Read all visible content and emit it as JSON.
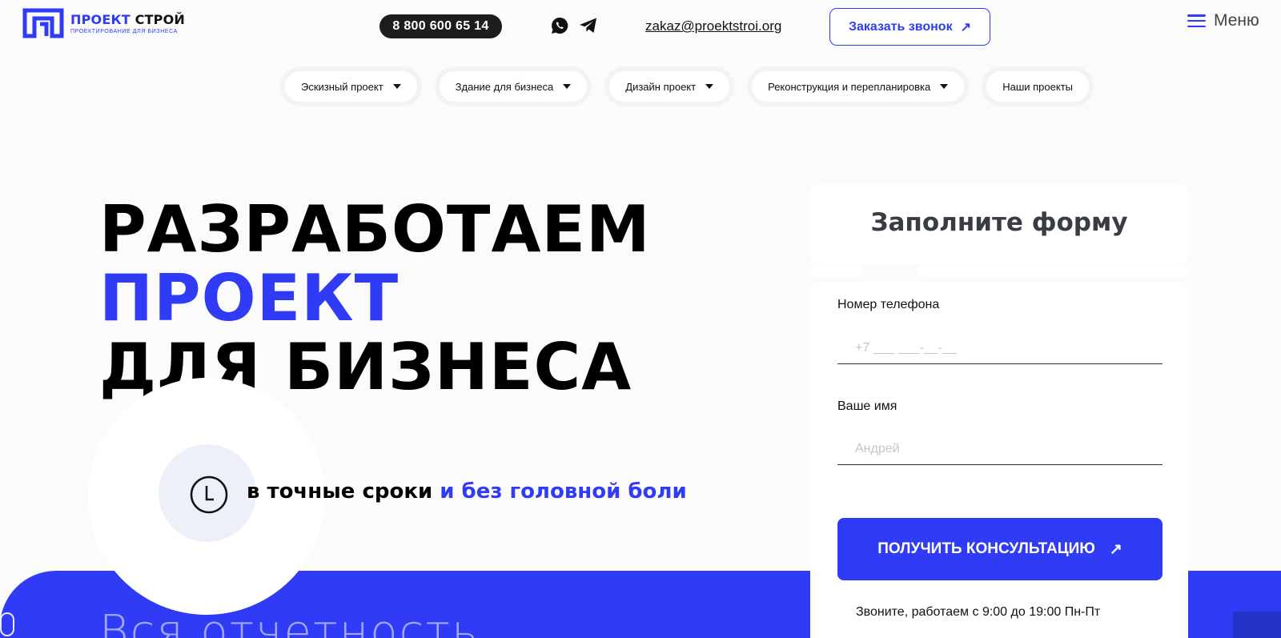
{
  "header": {
    "logo_title_accent": "ПРОЕКТ",
    "logo_title": "СТРОЙ",
    "logo_subtitle": "ПРОЕКТИРОВАНИЕ ДЛЯ БИЗНЕСА",
    "phone": "8 800 600 65 14",
    "whatsapp_icon": "whatsapp-icon",
    "telegram_icon": "telegram-icon",
    "email": "zakaz@proektstroi.org",
    "callback_label": "Заказать звонок",
    "callback_arrow": "↗",
    "menu_label": "Меню"
  },
  "nav": {
    "items": [
      {
        "label": "Эскизный проект",
        "has_dropdown": true
      },
      {
        "label": "Здание для бизнеса",
        "has_dropdown": true
      },
      {
        "label": "Дизайн проект",
        "has_dropdown": true
      },
      {
        "label": "Реконструкция и перепланировка",
        "has_dropdown": true
      },
      {
        "label": "Наши проекты",
        "has_dropdown": false
      }
    ]
  },
  "hero": {
    "line1": "РАЗРАБОТАЕМ",
    "line2": "ПРОЕКТ",
    "line3": "ДЛЯ БИЗНЕСА",
    "tagline_main": "в точные сроки",
    "tagline_accent": "и без головной боли",
    "band_text": "Вся отчетность",
    "clock_icon": "clock-icon"
  },
  "form": {
    "title": "Заполните форму",
    "phone_label": "Номер телефона",
    "phone_placeholder": "+7 ___ ___-__-__",
    "name_label": "Ваше имя",
    "name_placeholder": "Андрей",
    "submit_label": "ПОЛУЧИТЬ КОНСУЛЬТАЦИЮ",
    "submit_arrow": "↗",
    "hours": "Звоните, работаем с 9:00 до 19:00 Пн-Пт"
  },
  "colors": {
    "accent": "#2f3bf5",
    "dark": "#1d1d1d",
    "background": "#fbfbfc"
  }
}
